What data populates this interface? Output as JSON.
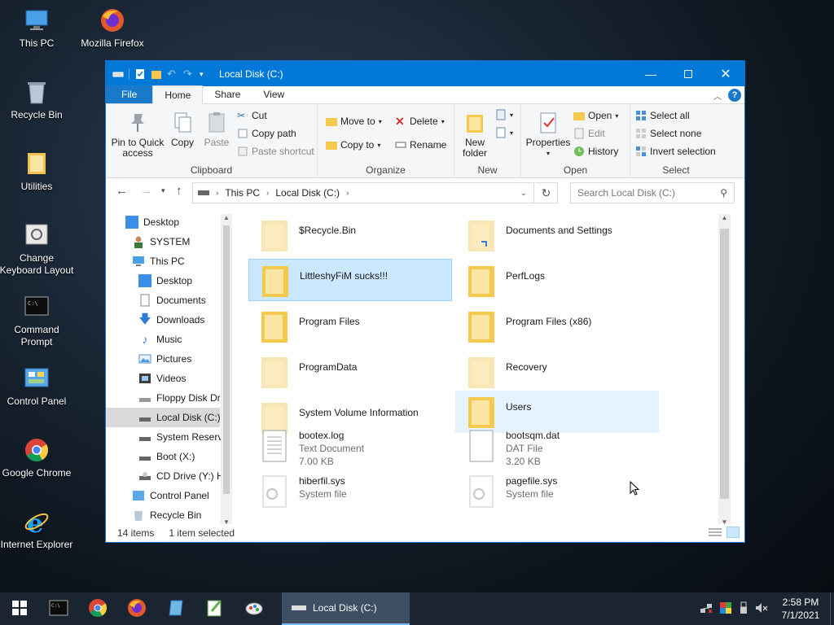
{
  "desktop": {
    "icons": [
      {
        "label": "This PC"
      },
      {
        "label": "Mozilla Firefox"
      },
      {
        "label": "Recycle Bin"
      },
      {
        "label": "Utilities"
      },
      {
        "label": "Change Keyboard Layout"
      },
      {
        "label": "Command Prompt"
      },
      {
        "label": "Control Panel"
      },
      {
        "label": "Google Chrome"
      },
      {
        "label": "Internet Explorer"
      }
    ]
  },
  "window": {
    "title": "Local Disk (C:)",
    "tabs": {
      "file": "File",
      "home": "Home",
      "share": "Share",
      "view": "View"
    },
    "ribbon": {
      "clipboard": {
        "label": "Clipboard",
        "pin": "Pin to Quick access",
        "copy": "Copy",
        "paste": "Paste",
        "cut": "Cut",
        "copy_path": "Copy path",
        "paste_shortcut": "Paste shortcut"
      },
      "organize": {
        "label": "Organize",
        "move_to": "Move to",
        "copy_to": "Copy to",
        "delete": "Delete",
        "rename": "Rename"
      },
      "new": {
        "label": "New",
        "new_folder": "New folder"
      },
      "open": {
        "label": "Open",
        "properties": "Properties",
        "open": "Open",
        "edit": "Edit",
        "history": "History"
      },
      "select": {
        "label": "Select",
        "select_all": "Select all",
        "select_none": "Select none",
        "invert": "Invert selection"
      }
    },
    "address": {
      "crumb1": "This PC",
      "crumb2": "Local Disk (C:)",
      "search_placeholder": "Search Local Disk (C:)"
    },
    "nav": [
      {
        "label": "Desktop"
      },
      {
        "label": "SYSTEM"
      },
      {
        "label": "This PC"
      },
      {
        "label": "Desktop"
      },
      {
        "label": "Documents"
      },
      {
        "label": "Downloads"
      },
      {
        "label": "Music"
      },
      {
        "label": "Pictures"
      },
      {
        "label": "Videos"
      },
      {
        "label": "Floppy Disk Dri"
      },
      {
        "label": "Local Disk (C:)"
      },
      {
        "label": "System Reserve"
      },
      {
        "label": "Boot (X:)"
      },
      {
        "label": "CD Drive (Y:) H"
      },
      {
        "label": "Control Panel"
      },
      {
        "label": "Recycle Bin"
      }
    ],
    "files": [
      {
        "name": "$Recycle.Bin"
      },
      {
        "name": "Documents and Settings"
      },
      {
        "name": "LittleshyFiM sucks!!!"
      },
      {
        "name": "PerfLogs"
      },
      {
        "name": "Program Files"
      },
      {
        "name": "Program Files (x86)"
      },
      {
        "name": "ProgramData"
      },
      {
        "name": "Recovery"
      },
      {
        "name": "System Volume Information"
      },
      {
        "name": "Users"
      },
      {
        "name": "bootex.log",
        "type": "Text Document",
        "size": "7.00 KB"
      },
      {
        "name": "bootsqm.dat",
        "type": "DAT File",
        "size": "3.20 KB"
      },
      {
        "name": "hiberfil.sys",
        "type": "System file"
      },
      {
        "name": "pagefile.sys",
        "type": "System file"
      }
    ],
    "status": {
      "count": "14 items",
      "selected": "1 item selected"
    }
  },
  "taskbar": {
    "active_window": "Local Disk (C:)",
    "time": "2:58 PM",
    "date": "7/1/2021"
  },
  "colors": {
    "accent": "#0078d7",
    "selection": "#cce8ff",
    "folder": "#f5c94e"
  }
}
